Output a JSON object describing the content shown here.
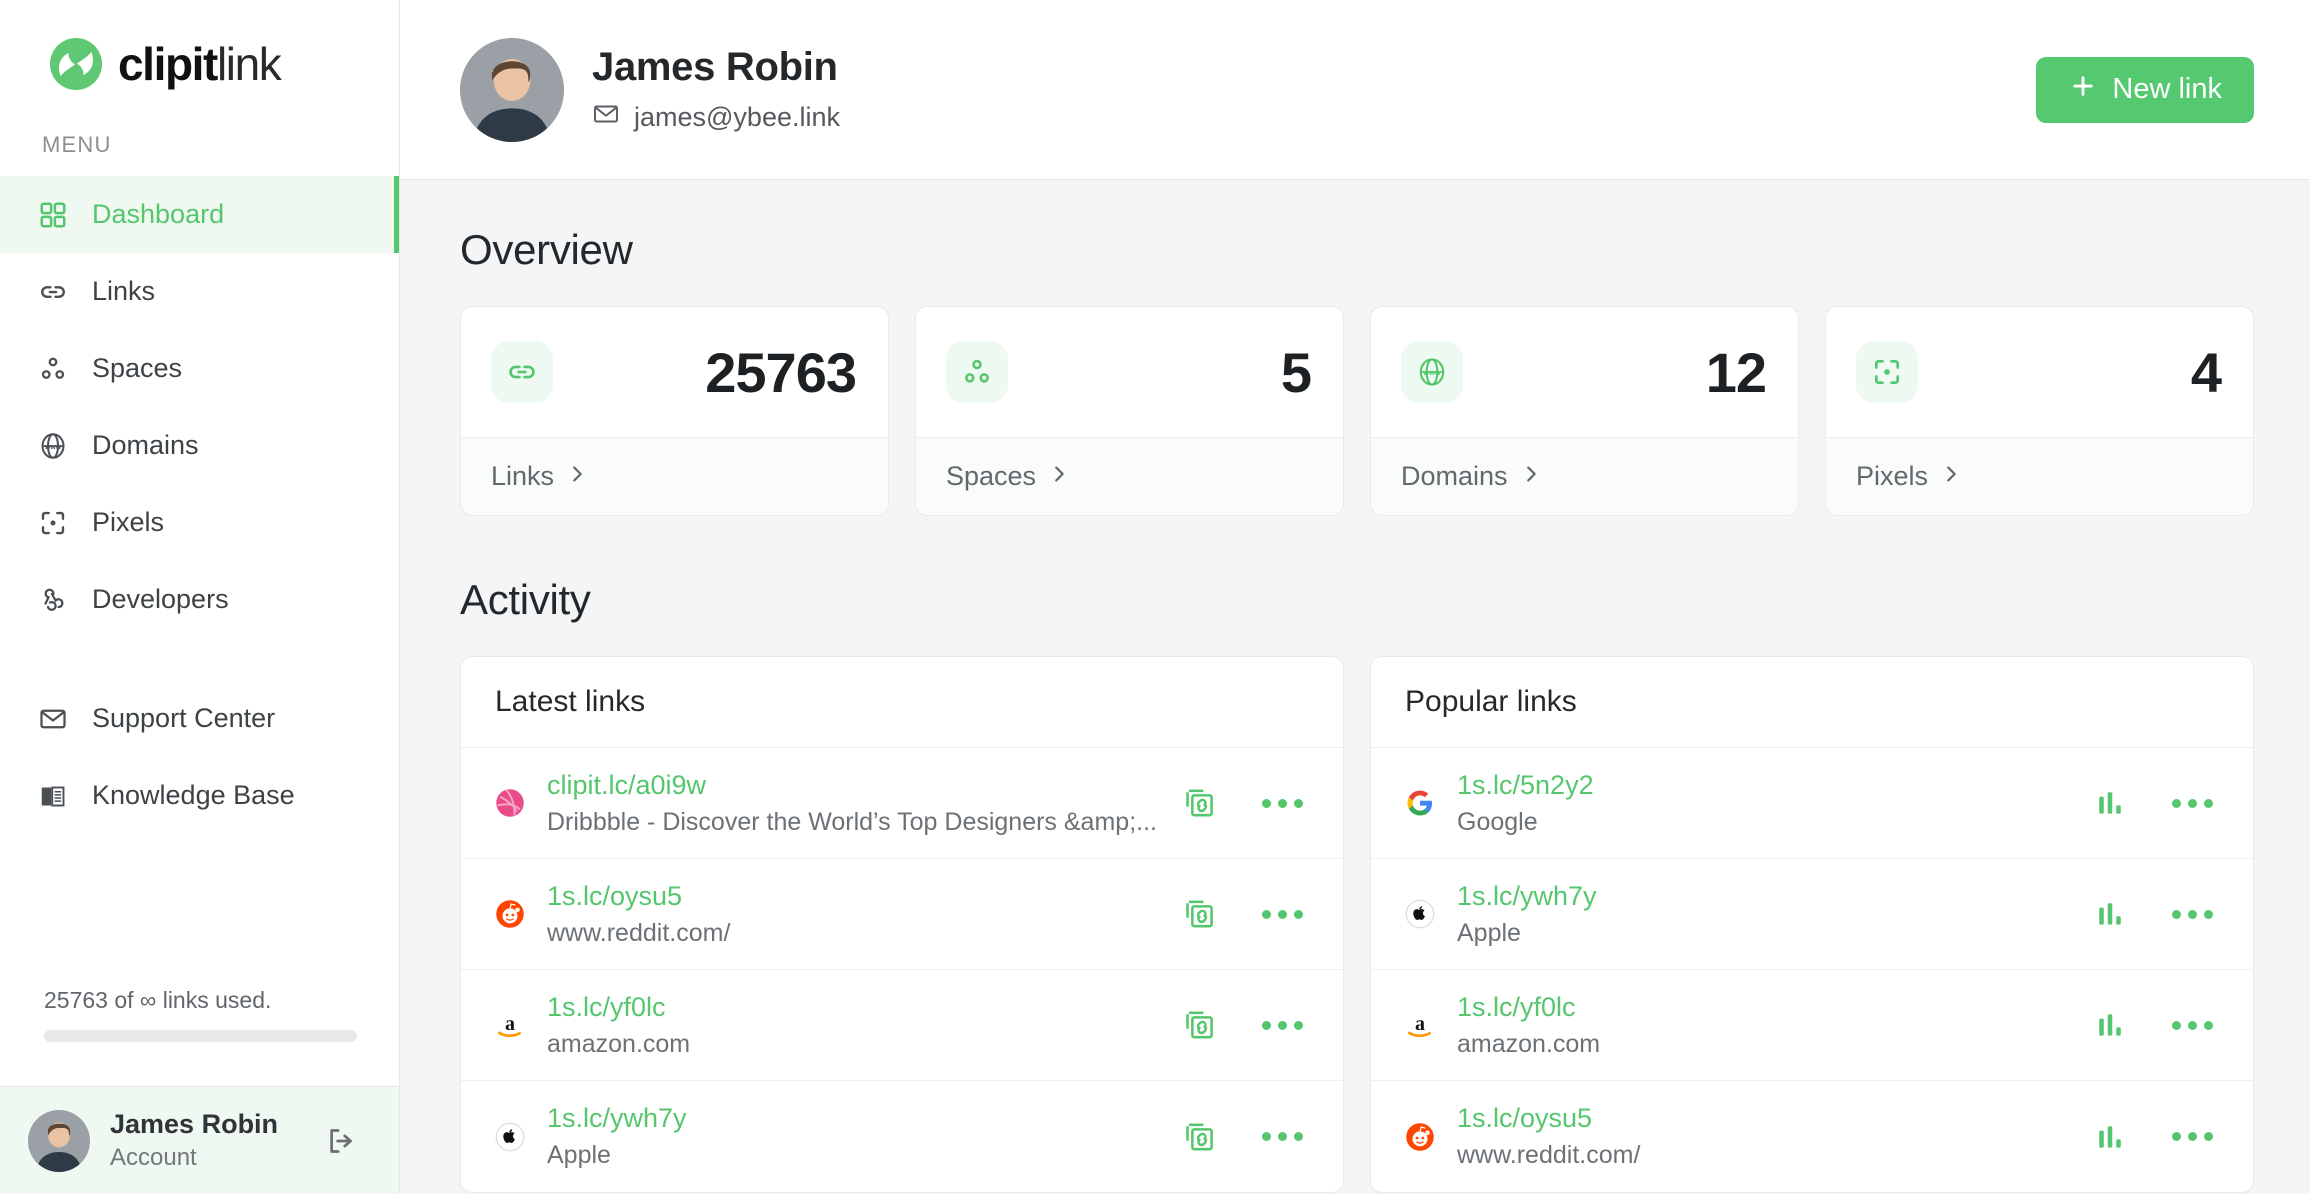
{
  "brand": {
    "name_bold": "clipit",
    "name_light": "link",
    "accent": "#55c66d",
    "accent_button": "#55c96f",
    "accent_soft": "#eff9f1"
  },
  "sidebar": {
    "menu_label": "MENU",
    "items": [
      {
        "label": "Dashboard",
        "icon": "grid-icon",
        "active": true
      },
      {
        "label": "Links",
        "icon": "link-icon",
        "active": false
      },
      {
        "label": "Spaces",
        "icon": "spaces-icon",
        "active": false
      },
      {
        "label": "Domains",
        "icon": "globe-www-icon",
        "active": false
      },
      {
        "label": "Pixels",
        "icon": "focus-target-icon",
        "active": false
      },
      {
        "label": "Developers",
        "icon": "webhook-icon",
        "active": false
      }
    ],
    "secondary_items": [
      {
        "label": "Support Center",
        "icon": "envelope-icon"
      },
      {
        "label": "Knowledge Base",
        "icon": "book-icon"
      }
    ],
    "usage": {
      "text": "25763 of ∞ links used.",
      "used": 25763,
      "limit": "∞",
      "percent": 0
    },
    "account": {
      "name": "James Robin",
      "role": "Account",
      "logout_icon": "logout-icon"
    }
  },
  "header": {
    "user_name": "James Robin",
    "user_email": "james@ybee.link",
    "email_icon": "envelope-icon",
    "new_link_button": "New link",
    "new_link_icon": "plus-icon"
  },
  "overview": {
    "title": "Overview",
    "cards": [
      {
        "value": "25763",
        "label": "Links",
        "icon": "link-icon"
      },
      {
        "value": "5",
        "label": "Spaces",
        "icon": "spaces-icon"
      },
      {
        "value": "12",
        "label": "Domains",
        "icon": "globe-www-icon"
      },
      {
        "value": "4",
        "label": "Pixels",
        "icon": "focus-target-icon"
      }
    ]
  },
  "activity": {
    "title": "Activity",
    "latest": {
      "heading": "Latest links",
      "rows": [
        {
          "short": "clipit.lc/a0i9w",
          "title": "Dribbble - Discover the World’s Top Designers &amp;...",
          "favicon": "dribbble-icon"
        },
        {
          "short": "1s.lc/oysu5",
          "title": "www.reddit.com/",
          "favicon": "reddit-icon"
        },
        {
          "short": "1s.lc/yf0lc",
          "title": "amazon.com",
          "favicon": "amazon-icon"
        },
        {
          "short": "1s.lc/ywh7y",
          "title": "Apple",
          "favicon": "apple-icon"
        }
      ],
      "action_icon": "copy-link-icon",
      "menu_icon": "more-options-icon"
    },
    "popular": {
      "heading": "Popular links",
      "rows": [
        {
          "short": "1s.lc/5n2y2",
          "title": "Google",
          "favicon": "google-icon"
        },
        {
          "short": "1s.lc/ywh7y",
          "title": "Apple",
          "favicon": "apple-icon"
        },
        {
          "short": "1s.lc/yf0lc",
          "title": "amazon.com",
          "favicon": "amazon-icon"
        },
        {
          "short": "1s.lc/oysu5",
          "title": "www.reddit.com/",
          "favicon": "reddit-icon"
        }
      ],
      "action_icon": "bar-chart-icon",
      "menu_icon": "more-options-icon"
    }
  }
}
